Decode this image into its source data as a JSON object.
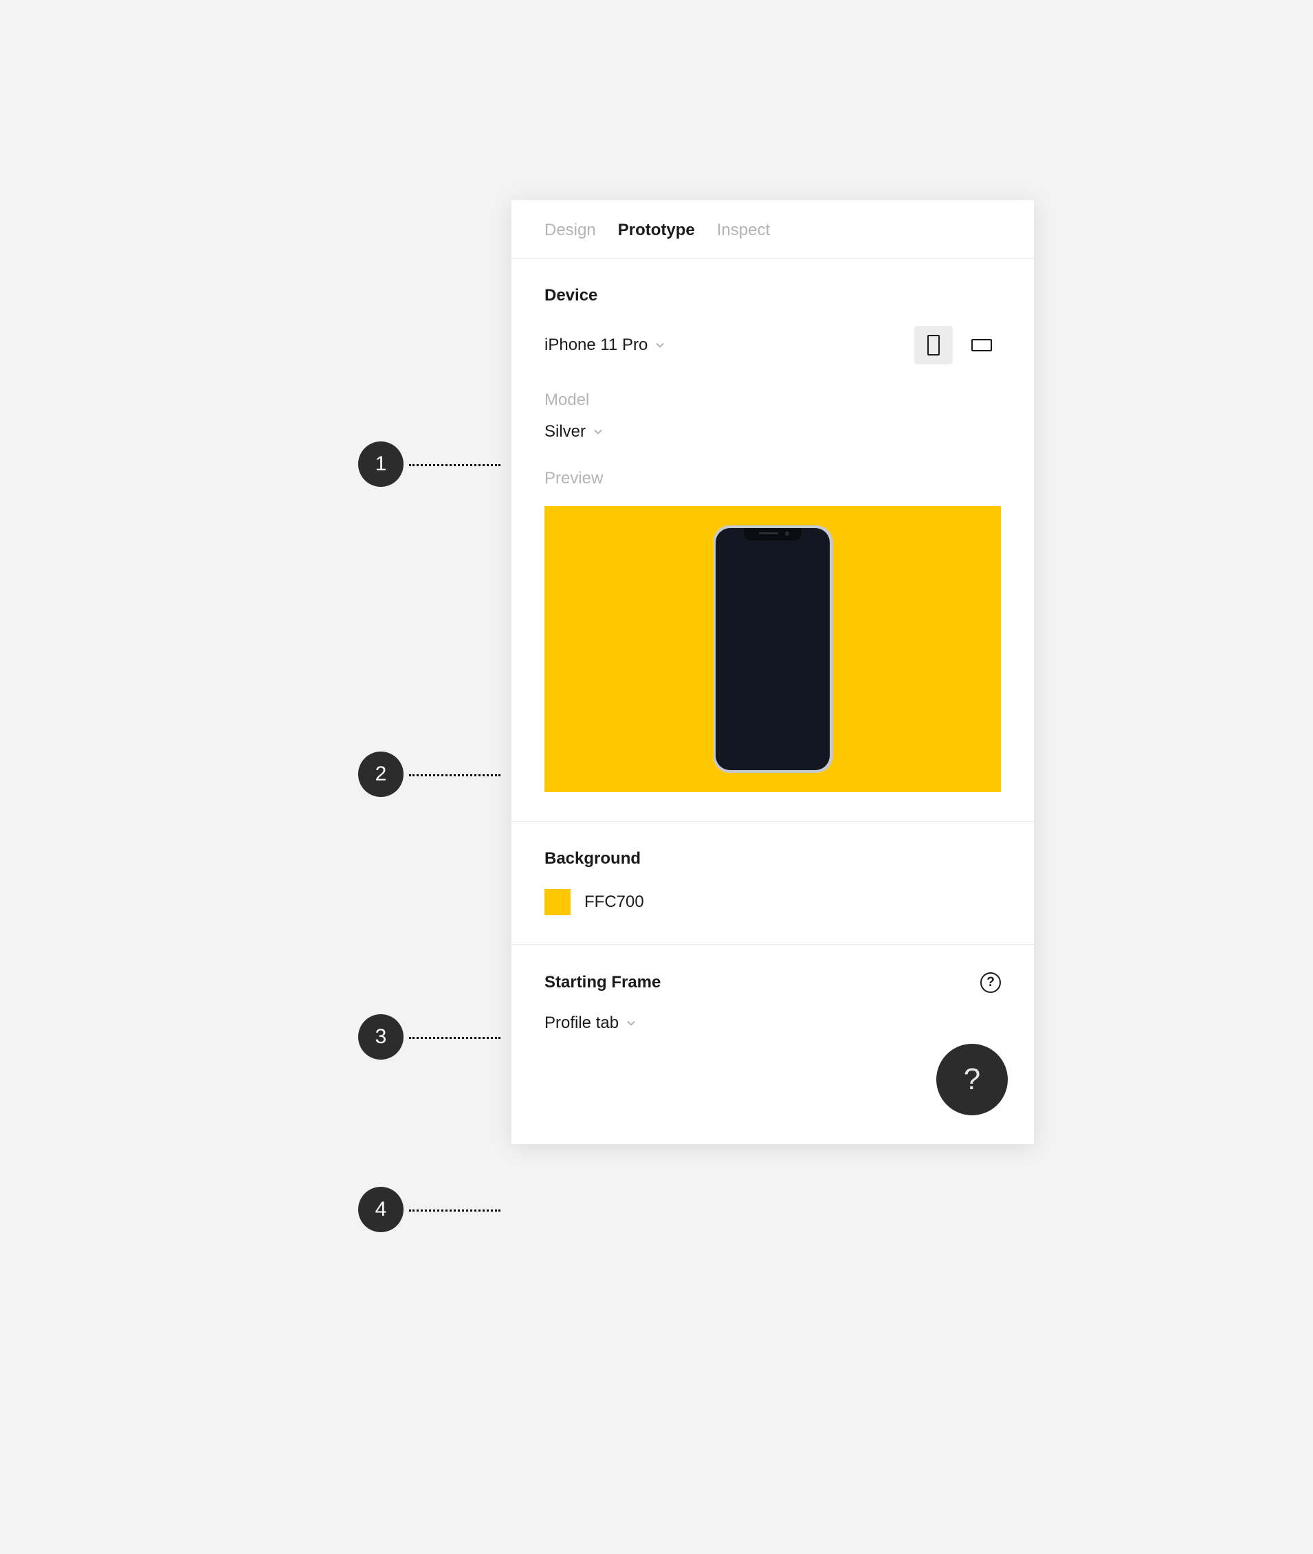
{
  "tabs": {
    "design": "Design",
    "prototype": "Prototype",
    "inspect": "Inspect"
  },
  "device": {
    "title": "Device",
    "selected": "iPhone 11 Pro",
    "model_label": "Model",
    "model_value": "Silver",
    "preview_label": "Preview"
  },
  "background": {
    "title": "Background",
    "hex": "FFC700",
    "color": "#FFC700"
  },
  "starting": {
    "title": "Starting Frame",
    "value": "Profile tab"
  },
  "callouts": [
    "1",
    "2",
    "3",
    "4"
  ],
  "glyphs": {
    "help": "?",
    "fab": "?"
  }
}
